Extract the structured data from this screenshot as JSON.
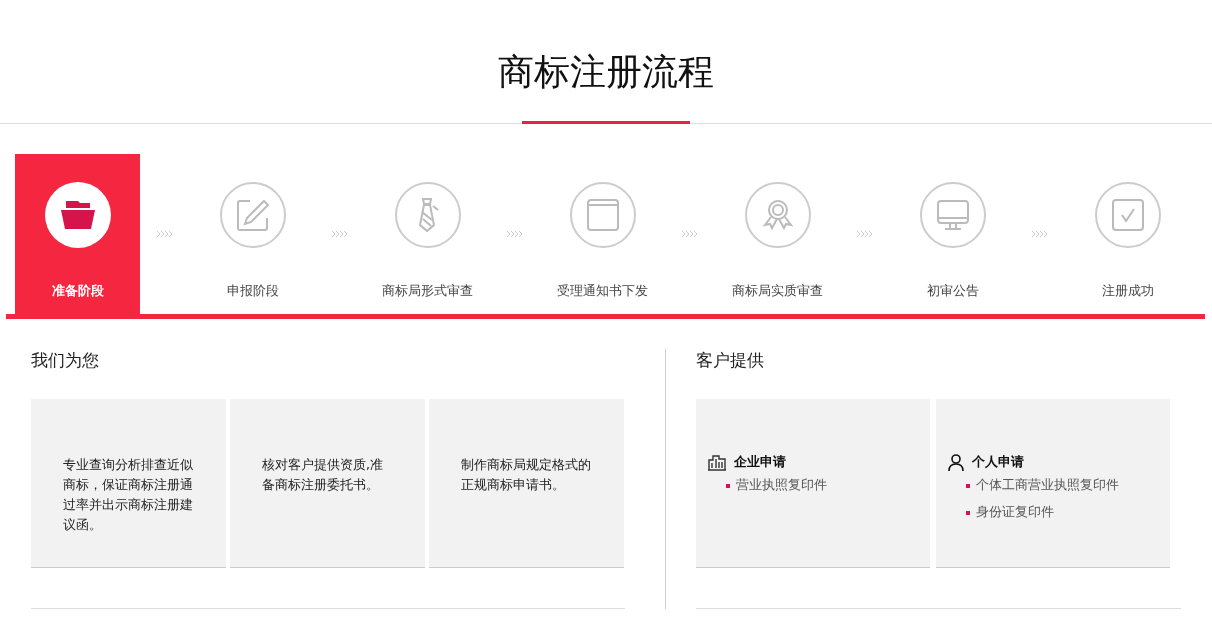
{
  "title": "商标注册流程",
  "steps": [
    {
      "label": "准备阶段",
      "selected": true
    },
    {
      "label": "申报阶段",
      "selected": false
    },
    {
      "label": "商标局形式审查",
      "selected": false
    },
    {
      "label": "受理通知书下发",
      "selected": false
    },
    {
      "label": "商标局实质审查",
      "selected": false
    },
    {
      "label": "初审公告",
      "selected": false
    },
    {
      "label": "注册成功",
      "selected": false
    }
  ],
  "we_provide": {
    "heading": "我们为您",
    "cards": [
      "专业查询分析排查近似商标，保证商标注册通过率并出示商标注册建议函。",
      "核对客户提供资质,准备商标注册委托书。",
      "制作商标局规定格式的正规商标申请书。"
    ]
  },
  "client_provides": {
    "heading": "客户提供",
    "cards": [
      {
        "kind": "company",
        "title": "企业申请",
        "items": [
          "营业执照复印件"
        ]
      },
      {
        "kind": "person",
        "title": "个人申请",
        "items": [
          "个体工商营业执照复印件",
          "身份证复印件"
        ]
      }
    ]
  }
}
